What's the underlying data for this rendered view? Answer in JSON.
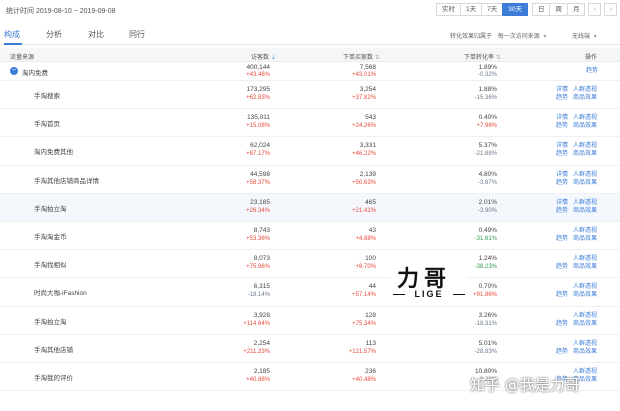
{
  "header": {
    "stat_time": "统计时间 2019-08-10 ~ 2019-09-08",
    "ranges": [
      "实时",
      "1天",
      "7天",
      "30天",
      "日",
      "周",
      "月"
    ],
    "active_range": "30天"
  },
  "tabs": [
    "构成",
    "分析",
    "对比",
    "同行"
  ],
  "active_tab": "构成",
  "metric_selects": [
    {
      "label": "转化效果归属于",
      "value": "每一次访问来源"
    },
    {
      "label": "",
      "value": "无线端"
    }
  ],
  "columns": [
    "流量来源",
    "访客数",
    "下单买家数",
    "下单转化率",
    "操作"
  ],
  "rows": [
    {
      "source": "淘内免费",
      "visitors": "400,144",
      "visitors_chg": "+43.46%",
      "buyers": "7,568",
      "buyers_chg": "+43.01%",
      "rate": "1.89%",
      "rate_chg": "-0.32%",
      "ops": [
        "趋势"
      ]
    },
    {
      "source": "手淘搜索",
      "visitors": "173,295",
      "visitors_chg": "+62.83%",
      "buyers": "3,254",
      "buyers_chg": "+37.82%",
      "rate": "1.88%",
      "rate_chg": "-15.36%",
      "ops": [
        "详情",
        "人群透视",
        "趋势",
        "商品效果"
      ]
    },
    {
      "source": "手淘首页",
      "visitors": "135,011",
      "visitors_chg": "+15.08%",
      "buyers": "543",
      "buyers_chg": "+24.26%",
      "rate": "0.40%",
      "rate_chg": "+7.98%",
      "ops": [
        "详情",
        "人群透视",
        "趋势",
        "商品效果"
      ]
    },
    {
      "source": "淘内免费其他",
      "visitors": "62,024",
      "visitors_chg": "+87.17%",
      "buyers": "3,331",
      "buyers_chg": "+46.22%",
      "rate": "5.37%",
      "rate_chg": "-21.88%",
      "ops": [
        "详情",
        "人群透视",
        "趋势",
        "商品效果"
      ]
    },
    {
      "source": "手淘其他店铺商品详情",
      "visitors": "44,598",
      "visitors_chg": "+58.37%",
      "buyers": "2,139",
      "buyers_chg": "+50.63%",
      "rate": "4.80%",
      "rate_chg": "-3.67%",
      "ops": [
        "详情",
        "人群透视",
        "趋势",
        "商品效果"
      ]
    },
    {
      "source": "手淘拍立淘",
      "visitors": "23,185",
      "visitors_chg": "+26.34%",
      "buyers": "465",
      "buyers_chg": "+21.41%",
      "rate": "2.01%",
      "rate_chg": "-3.90%",
      "ops": [
        "详情",
        "人群透视",
        "趋势",
        "商品效果"
      ]
    },
    {
      "source": "手淘淘金币",
      "visitors": "8,743",
      "visitors_chg": "+53.36%",
      "buyers": "43",
      "buyers_chg": "+4.88%",
      "rate": "0.49%",
      "rate_chg": "-31.61%",
      "ops": [
        "人群透视",
        "趋势",
        "商品效果"
      ]
    },
    {
      "source": "手淘找相似",
      "visitors": "8,073",
      "visitors_chg": "+75.96%",
      "buyers": "100",
      "buyers_chg": "+8.70%",
      "rate": "1.24%",
      "rate_chg": "-38.23%",
      "ops": [
        "人群透视",
        "趋势",
        "商品效果"
      ]
    },
    {
      "source": "时尚大咖-iFashion",
      "visitors": "6,315",
      "visitors_chg": "-18.14%",
      "buyers": "44",
      "buyers_chg": "+57.14%",
      "rate": "0.70%",
      "rate_chg": "+91.86%",
      "ops": [
        "人群透视",
        "趋势",
        "商品效果"
      ]
    },
    {
      "source": "手淘拍立淘",
      "visitors": "3,928",
      "visitors_chg": "+114.64%",
      "buyers": "128",
      "buyers_chg": "+75.34%",
      "rate": "3.26%",
      "rate_chg": "-18.31%",
      "ops": [
        "人群透视",
        "趋势",
        "商品效果"
      ]
    },
    {
      "source": "手淘其他店铺",
      "visitors": "2,254",
      "visitors_chg": "+211.33%",
      "buyers": "113",
      "buyers_chg": "+121.57%",
      "rate": "5.01%",
      "rate_chg": "-28.83%",
      "ops": [
        "人群透视",
        "趋势",
        "商品效果"
      ]
    },
    {
      "source": "手淘我的评价",
      "visitors": "2,185",
      "visitors_chg": "+40.88%",
      "buyers": "236",
      "buyers_chg": "+40.48%",
      "rate": "10.80%",
      "rate_chg": "-0.28%",
      "ops": [
        "人群透视",
        "趋势",
        "商品效果"
      ]
    }
  ],
  "watermark": {
    "big": "力哥",
    "small": "LIGE",
    "zhihu": "知乎 @我是力哥"
  },
  "colors": {
    "accent": "#3d7dd8",
    "up": "#e84a3c",
    "down": "#6c7a89",
    "green": "#2e9d4b"
  }
}
